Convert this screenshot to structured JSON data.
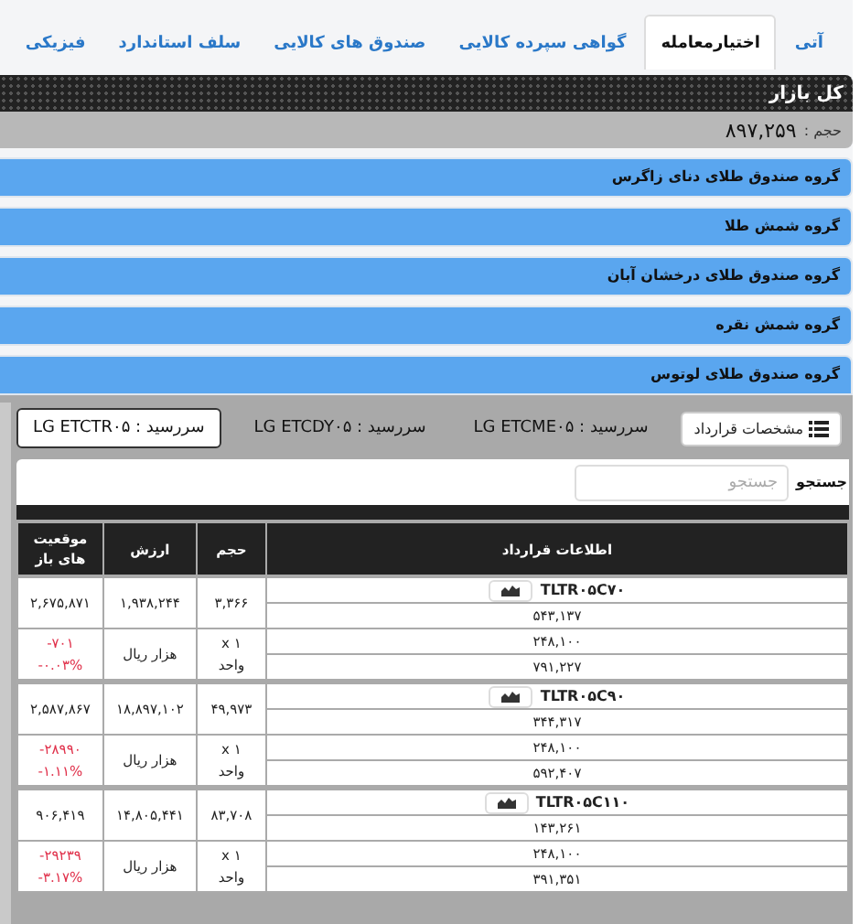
{
  "tabs": [
    {
      "label": "آتی",
      "selected": false
    },
    {
      "label": "اختیارمعامله",
      "selected": true
    },
    {
      "label": "گواهی سپرده کالایی",
      "selected": false
    },
    {
      "label": "صندوق های کالایی",
      "selected": false
    },
    {
      "label": "سلف استاندارد",
      "selected": false
    },
    {
      "label": "فیزیکی",
      "selected": false
    }
  ],
  "market": {
    "title": "کل بازار",
    "volume_label": "حجم :",
    "volume": "۸۹۷,۲۵۹"
  },
  "groups": [
    {
      "title": "گروه صندوق طلای دنای زاگرس",
      "expanded": false
    },
    {
      "title": "گروه شمش طلا",
      "expanded": false
    },
    {
      "title": "گروه صندوق طلای درخشان آبان",
      "expanded": false
    },
    {
      "title": "گروه شمش نقره",
      "expanded": false
    },
    {
      "title": "گروه صندوق طلای لوتوس",
      "expanded": true
    }
  ],
  "contract_button": "مشخصات قرارداد",
  "maturities": [
    {
      "label": "سررسید : LG ETCME۰۵",
      "selected": false
    },
    {
      "label": "سررسید : LG ETCDY۰۵",
      "selected": false
    },
    {
      "label": "سررسید : LG ETCTR۰۵",
      "selected": true
    }
  ],
  "search": {
    "label": "جستجو",
    "placeholder": "جستجو"
  },
  "table": {
    "columns": [
      "اطلاعات قرارداد",
      "حجم",
      "ارزش",
      "موقعیت های باز"
    ],
    "rows": [
      {
        "symbol": "TLTR۰۵C۷۰",
        "info": [
          "۵۴۳,۱۳۷",
          "۲۴۸,۱۰۰",
          "۷۹۱,۲۲۷"
        ],
        "volume": "۳,۳۶۶",
        "value": "۱,۹۳۸,۲۴۴",
        "open_interest": "۲,۶۷۵,۸۷۱",
        "size": "x ۱",
        "size_unit": "واحد",
        "value_unit": "هزار ریال",
        "change": "-۷۰۱",
        "change_percent": "-۰.۰۳%"
      },
      {
        "symbol": "TLTR۰۵C۹۰",
        "info": [
          "۳۴۴,۳۱۷",
          "۲۴۸,۱۰۰",
          "۵۹۲,۴۰۷"
        ],
        "volume": "۴۹,۹۷۳",
        "value": "۱۸,۸۹۷,۱۰۲",
        "open_interest": "۲,۵۸۷,۸۶۷",
        "size": "x ۱",
        "size_unit": "واحد",
        "value_unit": "هزار ریال",
        "change": "-۲۸۹۹۰",
        "change_percent": "-۱.۱۱%"
      },
      {
        "symbol": "TLTR۰۵C۱۱۰",
        "info": [
          "۱۴۳,۲۶۱",
          "۲۴۸,۱۰۰",
          "۳۹۱,۳۵۱"
        ],
        "volume": "۸۳,۷۰۸",
        "value": "۱۴,۸۰۵,۴۴۱",
        "open_interest": "۹۰۶,۴۱۹",
        "size": "x ۱",
        "size_unit": "واحد",
        "value_unit": "هزار ریال",
        "change": "-۲۹۲۳۹",
        "change_percent": "-۳.۱۷%"
      }
    ]
  }
}
